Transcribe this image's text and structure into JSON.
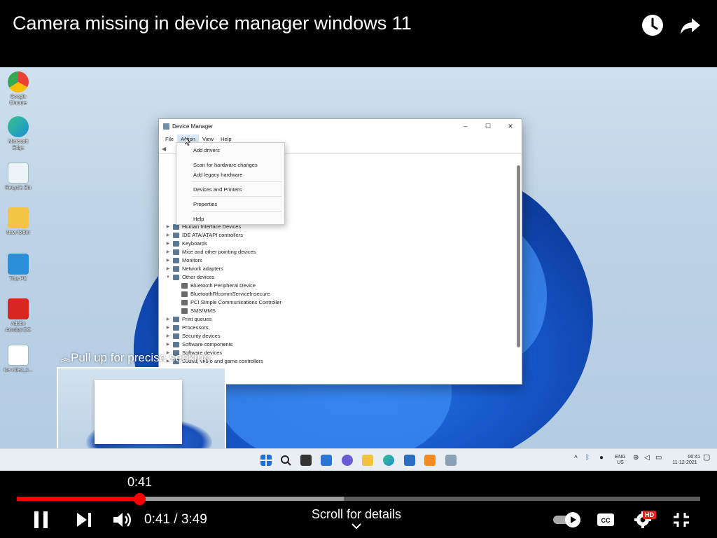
{
  "header": {
    "title": "Camera missing in device manager windows 11",
    "icons": [
      "clock-icon",
      "share-icon"
    ]
  },
  "desktop": {
    "icons": [
      {
        "name": "chrome-icon",
        "label": "Google Chrome",
        "color": "#e94235"
      },
      {
        "name": "edge-icon",
        "label": "Microsoft Edge",
        "color": "#1a8fd6"
      },
      {
        "name": "recycle-bin-icon",
        "label": "Recycle Bin",
        "color": "#dfe8ef"
      },
      {
        "name": "folder-icon",
        "label": "New folder",
        "color": "#f6c445"
      },
      {
        "name": "this-pc-icon",
        "label": "This PC",
        "color": "#2b8fd8"
      },
      {
        "name": "acrobat-icon",
        "label": "Adobe Acrobat DC",
        "color": "#d8271f"
      },
      {
        "name": "video-file-icon",
        "label": "ice video_k...",
        "color": "#2b7bd0"
      }
    ]
  },
  "device_manager": {
    "title": "Device Manager",
    "window_controls": [
      "–",
      "☐",
      "✕"
    ],
    "menu": [
      "File",
      "Action",
      "View",
      "Help"
    ],
    "active_menu": "Action",
    "action_menu": {
      "items": [
        "Add drivers",
        "Scan for hardware changes",
        "Add legacy hardware",
        "Devices and Printers",
        "Properties",
        "Help"
      ]
    },
    "tree": [
      {
        "label": "Human Interface Devices",
        "expanded": false,
        "child": false
      },
      {
        "label": "IDE ATA/ATAPI controllers",
        "expanded": false,
        "child": false
      },
      {
        "label": "Keyboards",
        "expanded": false,
        "child": false
      },
      {
        "label": "Mice and other pointing devices",
        "expanded": false,
        "child": false
      },
      {
        "label": "Monitors",
        "expanded": false,
        "child": false
      },
      {
        "label": "Network adapters",
        "expanded": false,
        "child": false
      },
      {
        "label": "Other devices",
        "expanded": true,
        "child": false
      },
      {
        "label": "Bluetooth Peripheral Device",
        "expanded": false,
        "child": true
      },
      {
        "label": "BluetoothRfcommServiceInsecure",
        "expanded": false,
        "child": true
      },
      {
        "label": "PCI Simple Communications Controller",
        "expanded": false,
        "child": true
      },
      {
        "label": "SMS/MMS",
        "expanded": false,
        "child": true
      },
      {
        "label": "Print queues",
        "expanded": false,
        "child": false
      },
      {
        "label": "Processors",
        "expanded": false,
        "child": false
      },
      {
        "label": "Security devices",
        "expanded": false,
        "child": false
      },
      {
        "label": "Software components",
        "expanded": false,
        "child": false
      },
      {
        "label": "Software devices",
        "expanded": false,
        "child": false
      },
      {
        "label": "Sound, video and game controllers",
        "expanded": false,
        "child": false
      }
    ]
  },
  "seek_preview": {
    "hint": "Pull up for precise seeking"
  },
  "taskbar": {
    "language_top": "ENG",
    "language_bottom": "US",
    "clock_time": "00:41",
    "clock_date": "11-12-2021"
  },
  "player": {
    "hover_time": "0:41",
    "current_time": "0:41",
    "separator": " / ",
    "duration": "3:49",
    "time_display": "0:41 / 3:49",
    "progress_fraction": 0.179,
    "buffered_fraction": 0.478,
    "scroll_hint": "Scroll for details",
    "hd_label": "HD",
    "progress_color": "#ff0000",
    "icons": [
      "pause-icon",
      "next-icon",
      "volume-icon",
      "autoplay-toggle-icon",
      "captions-icon",
      "settings-icon",
      "exit-fullscreen-icon"
    ]
  }
}
